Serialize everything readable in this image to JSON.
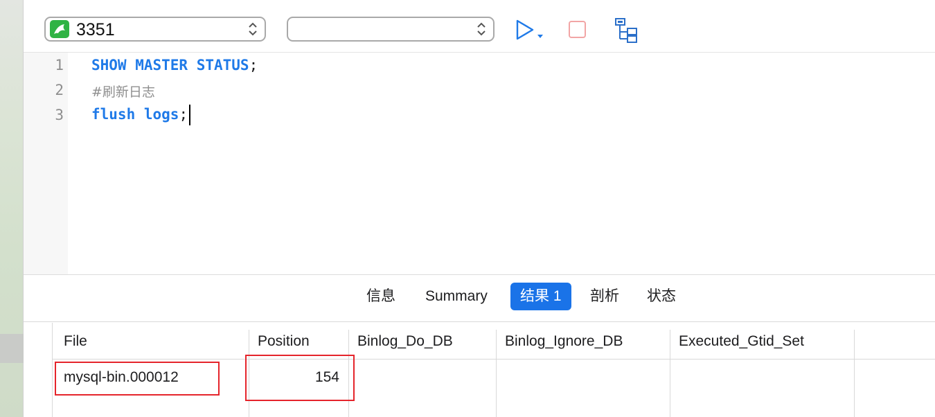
{
  "toolbar": {
    "connection": "3351",
    "database": "",
    "run_icon": "play-icon",
    "stop_icon": "stop-icon",
    "explain_icon": "explain-icon"
  },
  "editor": {
    "lines": [
      {
        "num": "1",
        "kw": "SHOW MASTER STATUS",
        "punct": ";"
      },
      {
        "num": "2",
        "comment": "#刷新日志"
      },
      {
        "num": "3",
        "kw": "flush logs",
        "punct": ";"
      }
    ]
  },
  "tabs": [
    "信息",
    "Summary",
    "结果 1",
    "剖析",
    "状态"
  ],
  "active_tab": "结果 1",
  "result": {
    "columns": [
      "File",
      "Position",
      "Binlog_Do_DB",
      "Binlog_Ignore_DB",
      "Executed_Gtid_Set"
    ],
    "rows": [
      [
        "mysql-bin.000012",
        "154",
        "",
        "",
        ""
      ]
    ]
  },
  "colors": {
    "keyword": "#1f7ae8",
    "active_tab": "#1a73e8",
    "highlight": "#e5242b",
    "mysql_icon": "#2fb344"
  }
}
